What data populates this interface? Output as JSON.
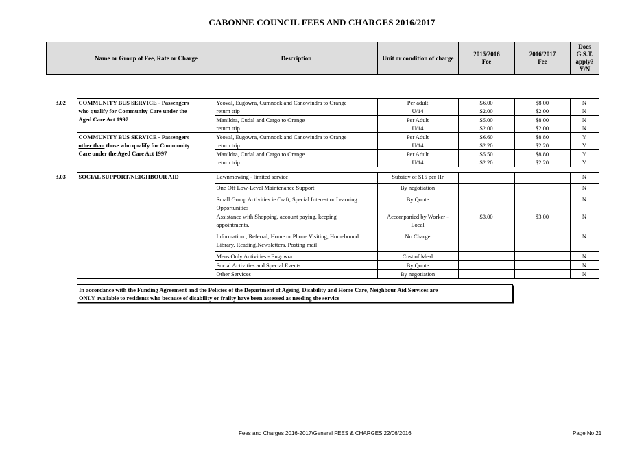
{
  "title": "CABONNE COUNCIL FEES AND CHARGES 2016/2017",
  "header": {
    "col_name": "Name or Group of Fee, Rate or Charge",
    "col_desc": "Description",
    "col_unit": "Unit or condition of charge",
    "col_fee1_line1": "2015/2016",
    "col_fee1_line2": "Fee",
    "col_fee2_line1": "2016/2017",
    "col_fee2_line2": "Fee",
    "col_gst_line1": "Does",
    "col_gst_line2": "G.S.T.",
    "col_gst_line3": "apply?",
    "col_gst_line4": "Y/N"
  },
  "section_302": {
    "number": "3.02",
    "group1_line1": "COMMUNITY BUS SERVICE -  Passengers",
    "group1_line2_u": "who qualify",
    "group1_line2_rest": " for Community Care under the",
    "group1_line3": "Aged Care Act 1997",
    "group2_line1": "COMMUNITY BUS SERVICE -  Passengers",
    "group2_line2_u": "other than",
    "group2_line2_rest": " those who qualify for Community",
    "group2_line3": "Care under the Aged Care Act 1997",
    "rows": [
      {
        "desc": "Yeoval, Eugowra, Cumnock and Canowindra to Orange",
        "unit": "Per adult",
        "fee1": "$6.00",
        "fee2": "$8.00",
        "gst": "N"
      },
      {
        "desc": "return trip",
        "unit": "U/14",
        "fee1": "$2.00",
        "fee2": "$2.00",
        "gst": "N"
      },
      {
        "desc": "Manildra, Cudal and Cargo to Orange",
        "unit": "Per Adult",
        "fee1": "$5.00",
        "fee2": "$8.00",
        "gst": "N"
      },
      {
        "desc": "return trip",
        "unit": "U/14",
        "fee1": "$2.00",
        "fee2": "$2.00",
        "gst": "N"
      },
      {
        "desc": "Yeoval, Eugowra, Cumnock and Canowindra to Orange",
        "unit": "Per Adult",
        "fee1": "$6.60",
        "fee2": "$8.80",
        "gst": "Y"
      },
      {
        "desc": "return trip",
        "unit": "U/14",
        "fee1": "$2.20",
        "fee2": "$2.20",
        "gst": "Y"
      },
      {
        "desc": "Manildra, Cudal and Cargo to Orange",
        "unit": "Per Adult",
        "fee1": "$5.50",
        "fee2": "$8.80",
        "gst": "Y"
      },
      {
        "desc": "return trip",
        "unit": "U/14",
        "fee1": "$2.20",
        "fee2": "$2.20",
        "gst": "Y"
      }
    ]
  },
  "section_303": {
    "number": "3.03",
    "group": "SOCIAL SUPPORT/NEIGHBOUR AID",
    "rows": [
      {
        "desc1": "Lawnmowing  - limited service",
        "desc2": "",
        "unit1": "Subsidy of $15 per Hr",
        "unit2": "",
        "fee1": "",
        "fee2": "",
        "gst": "N"
      },
      {
        "desc1": "One Off Low-Level Maintenance Support",
        "desc2": "",
        "unit1": "By negotiation",
        "unit2": "",
        "fee1": "",
        "fee2": "",
        "gst": "N"
      },
      {
        "desc1": "Small Group Activities ie Craft, Special Interest or Learning",
        "desc2": "Opportunities",
        "unit1": "By Quote",
        "unit2": "",
        "fee1": "",
        "fee2": "",
        "gst": "N"
      },
      {
        "desc1": "Assistance with Shopping, account paying, keeping",
        "desc2": "appointments.",
        "unit1": "Accompanied by Worker -",
        "unit2": "Local",
        "fee1": "$3.00",
        "fee2": "$3.00",
        "gst": "N"
      },
      {
        "desc1": "Information , Referral, Home  or Phone Visiting, Homebound",
        "desc2": "Library, Reading,Newsletters, Posting mail",
        "unit1": "No Charge",
        "unit2": "",
        "fee1": "",
        "fee2": "",
        "gst": "N"
      },
      {
        "desc1": "Mens Only Activities - Eugowra",
        "desc2": "",
        "unit1": "Cost of Meal",
        "unit2": "",
        "fee1": "",
        "fee2": "",
        "gst": "N"
      },
      {
        "desc1": "Social Activities and Special Events",
        "desc2": "",
        "unit1": "By Quote",
        "unit2": "",
        "fee1": "",
        "fee2": "",
        "gst": "N"
      },
      {
        "desc1": "Other Services",
        "desc2": "",
        "unit1": "By negotiation",
        "unit2": "",
        "fee1": "",
        "fee2": "",
        "gst": "N"
      }
    ]
  },
  "notice": {
    "line1": "In accordance with the Funding Agreement and the Policies of the Department of Ageing, Disability and Home Care, Neighbour Aid Services are",
    "line2": "ONLY available to residents who because of disability or frailty have been assessed as needing the service"
  },
  "footer": {
    "path": "Fees and Charges 2016-2017\\General FEES & CHARGES 22/06/2016",
    "page": "Page No 21"
  }
}
